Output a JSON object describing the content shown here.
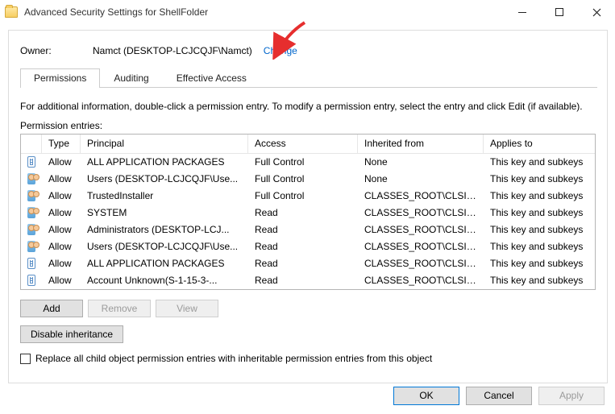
{
  "window": {
    "title": "Advanced Security Settings for ShellFolder"
  },
  "owner": {
    "label": "Owner:",
    "value": "Namct (DESKTOP-LCJCQJF\\Namct)",
    "change": "Change"
  },
  "tabs": {
    "items": [
      "Permissions",
      "Auditing",
      "Effective Access"
    ],
    "active": 0
  },
  "instruction": "For additional information, double-click a permission entry. To modify a permission entry, select the entry and click Edit (if available).",
  "entries_label": "Permission entries:",
  "columns": {
    "type": "Type",
    "principal": "Principal",
    "access": "Access",
    "inherited": "Inherited from",
    "applies": "Applies to"
  },
  "rows": [
    {
      "icon": "app",
      "type": "Allow",
      "principal": "ALL APPLICATION PACKAGES",
      "access": "Full Control",
      "inherited": "None",
      "applies": "This key and subkeys"
    },
    {
      "icon": "users",
      "type": "Allow",
      "principal": "Users (DESKTOP-LCJCQJF\\Use...",
      "access": "Full Control",
      "inherited": "None",
      "applies": "This key and subkeys"
    },
    {
      "icon": "users",
      "type": "Allow",
      "principal": "TrustedInstaller",
      "access": "Full Control",
      "inherited": "CLASSES_ROOT\\CLSID...",
      "applies": "This key and subkeys"
    },
    {
      "icon": "users",
      "type": "Allow",
      "principal": "SYSTEM",
      "access": "Read",
      "inherited": "CLASSES_ROOT\\CLSID...",
      "applies": "This key and subkeys"
    },
    {
      "icon": "users",
      "type": "Allow",
      "principal": "Administrators (DESKTOP-LCJ...",
      "access": "Read",
      "inherited": "CLASSES_ROOT\\CLSID...",
      "applies": "This key and subkeys"
    },
    {
      "icon": "users",
      "type": "Allow",
      "principal": "Users (DESKTOP-LCJCQJF\\Use...",
      "access": "Read",
      "inherited": "CLASSES_ROOT\\CLSID...",
      "applies": "This key and subkeys"
    },
    {
      "icon": "app",
      "type": "Allow",
      "principal": "ALL APPLICATION PACKAGES",
      "access": "Read",
      "inherited": "CLASSES_ROOT\\CLSID...",
      "applies": "This key and subkeys"
    },
    {
      "icon": "app",
      "type": "Allow",
      "principal": "Account Unknown(S-1-15-3-...",
      "access": "Read",
      "inherited": "CLASSES_ROOT\\CLSID...",
      "applies": "This key and subkeys"
    }
  ],
  "buttons": {
    "add": "Add",
    "remove": "Remove",
    "view": "View",
    "disable": "Disable inheritance"
  },
  "checkbox": {
    "label": "Replace all child object permission entries with inheritable permission entries from this object"
  },
  "footer": {
    "ok": "OK",
    "cancel": "Cancel",
    "apply": "Apply"
  }
}
